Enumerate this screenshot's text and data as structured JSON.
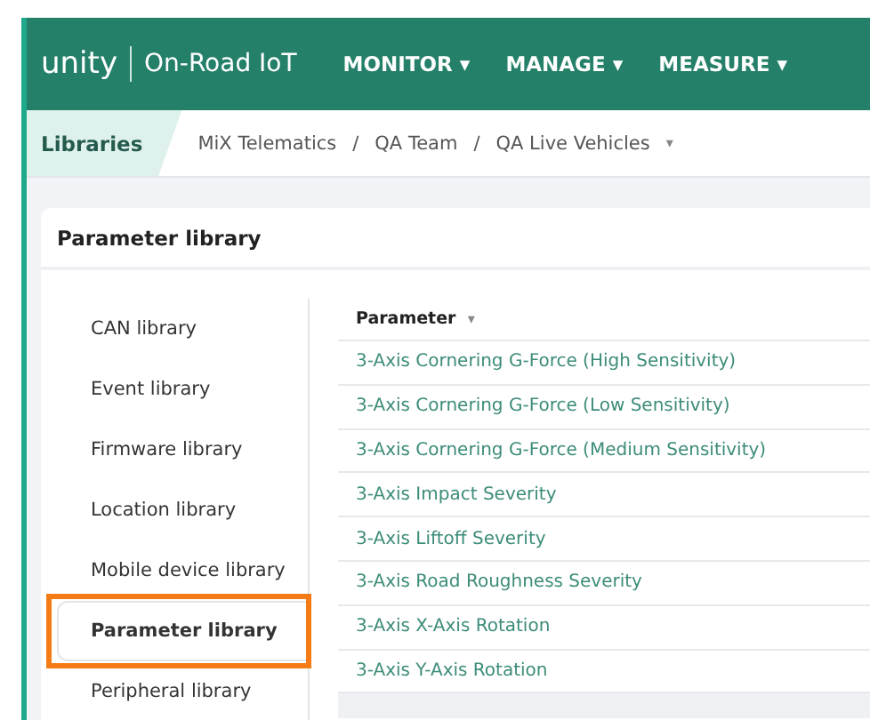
{
  "header": {
    "logo": "unity",
    "product": "On-Road IoT",
    "menus": [
      {
        "label": "MONITOR",
        "caret": "▾"
      },
      {
        "label": "MANAGE",
        "caret": "▾"
      },
      {
        "label": "MEASURE",
        "caret": "▾"
      }
    ]
  },
  "breadcrumb": {
    "section": "Libraries",
    "path": [
      "MiX Telematics",
      "QA Team",
      "QA Live Vehicles"
    ],
    "separator": "/",
    "caret": "▾"
  },
  "card": {
    "title": "Parameter library"
  },
  "sidebar": {
    "items": [
      {
        "label": "CAN library",
        "selected": false,
        "highlighted": false
      },
      {
        "label": "Event library",
        "selected": false,
        "highlighted": false
      },
      {
        "label": "Firmware library",
        "selected": false,
        "highlighted": false
      },
      {
        "label": "Location library",
        "selected": false,
        "highlighted": false
      },
      {
        "label": "Mobile device library",
        "selected": false,
        "highlighted": false
      },
      {
        "label": "Parameter library",
        "selected": true,
        "highlighted": true
      },
      {
        "label": "Peripheral library",
        "selected": false,
        "highlighted": false
      }
    ]
  },
  "table": {
    "columns": [
      {
        "label": "Parameter",
        "caret": "▾"
      }
    ],
    "rows": [
      "3-Axis Cornering G-Force (High Sensitivity)",
      "3-Axis Cornering G-Force (Low Sensitivity)",
      "3-Axis Cornering G-Force (Medium Sensitivity)",
      "3-Axis Impact Severity",
      "3-Axis Liftoff Severity",
      "3-Axis Road Roughness Severity",
      "3-Axis X-Axis Rotation",
      "3-Axis Y-Axis Rotation"
    ]
  }
}
